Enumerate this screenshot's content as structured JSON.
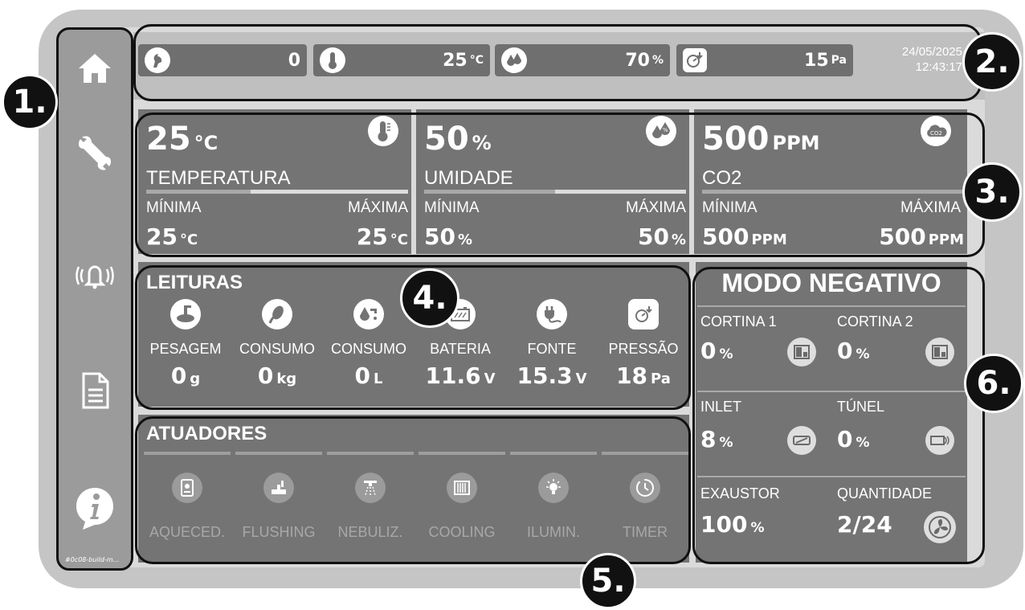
{
  "sidebar": {
    "items": [
      {
        "icon": "home-icon"
      },
      {
        "icon": "wrench-icon"
      },
      {
        "icon": "alarm-bell-icon"
      },
      {
        "icon": "document-icon"
      },
      {
        "icon": "info-icon"
      }
    ],
    "footer": "#0c08-build-m..."
  },
  "topbar": {
    "chips": [
      {
        "icon": "bird-icon",
        "value": "0",
        "unit": ""
      },
      {
        "icon": "thermometer-icon",
        "value": "25",
        "unit": "°C"
      },
      {
        "icon": "humidity-drops-icon",
        "value": "70",
        "unit": "%"
      },
      {
        "icon": "pressure-gauge-icon",
        "value": "15",
        "unit": "Pa"
      }
    ],
    "date": "24/05/2025",
    "time": "12:43:17"
  },
  "sensors": [
    {
      "value": "25",
      "unit": "°C",
      "name": "TEMPERATURA",
      "icon": "thermometer-icon",
      "bar_fill": 0.4,
      "min_label": "MÍNIMA",
      "max_label": "MÁXIMA",
      "min_value": "25",
      "min_unit": "°C",
      "max_value": "25",
      "max_unit": "°C"
    },
    {
      "value": "50",
      "unit": "%",
      "name": "UMIDADE",
      "icon": "humidity-percent-icon",
      "bar_fill": 0.5,
      "min_label": "MÍNIMA",
      "max_label": "MÁXIMA",
      "min_value": "50",
      "min_unit": "%",
      "max_value": "50",
      "max_unit": "%"
    },
    {
      "value": "500",
      "unit": "PPM",
      "name": "CO2",
      "icon": "co2-cloud-icon",
      "bar_fill": 1.0,
      "min_label": "MÍNIMA",
      "max_label": "MÁXIMA",
      "min_value": "500",
      "min_unit": "PPM",
      "max_value": "500",
      "max_unit": "PPM"
    }
  ],
  "leituras": {
    "title": "LEITURAS",
    "items": [
      {
        "icon": "scale-icon",
        "label": "PESAGEM",
        "value": "0",
        "unit": "g"
      },
      {
        "icon": "corn-icon",
        "label": "CONSUMO",
        "value": "0",
        "unit": "kg"
      },
      {
        "icon": "water-tap-icon",
        "label": "CONSUMO",
        "value": "0",
        "unit": "L"
      },
      {
        "icon": "battery-icon",
        "label": "BATERIA",
        "value": "11.6",
        "unit": "V"
      },
      {
        "icon": "power-plug-icon",
        "label": "FONTE",
        "value": "15.3",
        "unit": "V"
      },
      {
        "icon": "pressure-gauge-icon",
        "label": "PRESSÃO",
        "value": "18",
        "unit": "Pa"
      }
    ]
  },
  "atuadores": {
    "title": "ATUADORES",
    "items": [
      {
        "icon": "heater-icon",
        "label": "AQUECED."
      },
      {
        "icon": "flushing-icon",
        "label": "FLUSHING"
      },
      {
        "icon": "nebulizer-icon",
        "label": "NEBULIZ."
      },
      {
        "icon": "cooling-pad-icon",
        "label": "COOLING"
      },
      {
        "icon": "lightbulb-icon",
        "label": "ILUMIN."
      },
      {
        "icon": "timer-icon",
        "label": "TIMER"
      }
    ]
  },
  "negativo": {
    "title": "MODO NEGATIVO",
    "cortina1": {
      "label": "CORTINA 1",
      "value": "0",
      "unit": "%",
      "icon": "curtain-icon"
    },
    "cortina2": {
      "label": "CORTINA 2",
      "value": "0",
      "unit": "%",
      "icon": "curtain-icon"
    },
    "inlet": {
      "label": "INLET",
      "value": "8",
      "unit": "%",
      "icon": "inlet-icon"
    },
    "tunel": {
      "label": "TÚNEL",
      "value": "0",
      "unit": "%",
      "icon": "tunnel-icon"
    },
    "exaustor": {
      "label": "EXAUSTOR",
      "value": "100",
      "unit": "%"
    },
    "quantidade": {
      "label": "QUANTIDADE",
      "value": "2/24",
      "icon": "fan-icon"
    }
  },
  "callouts": [
    "1.",
    "2.",
    "3.",
    "4.",
    "5.",
    "6."
  ]
}
